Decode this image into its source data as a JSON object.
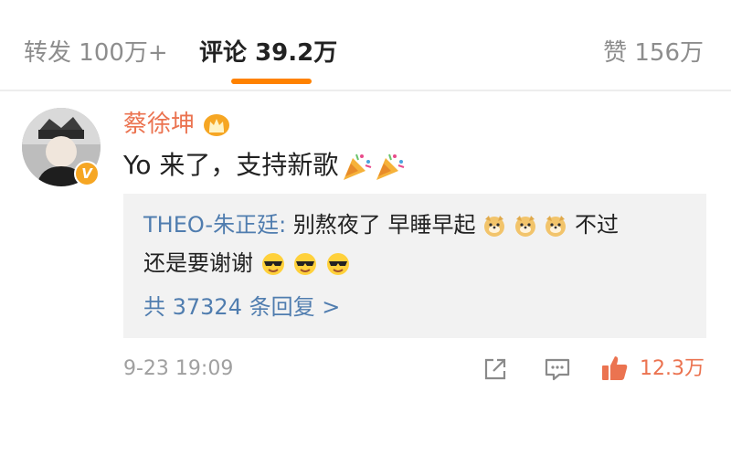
{
  "tabs": {
    "repost_label": "转发",
    "repost_count": "100万+",
    "comments_label": "评论",
    "comments_count": "39.2万",
    "likes_label": "赞",
    "likes_count": "156万"
  },
  "comment": {
    "username": "蔡徐坤",
    "text": "Yo 来了，支持新歌",
    "emoji": [
      "party-popper",
      "party-popper"
    ],
    "time": "9-23 19:09",
    "like_count": "12.3万"
  },
  "reply": {
    "user": "THEO-朱正廷",
    "separator": ": ",
    "text_part1": "别熬夜了 早睡早起",
    "emoji_part1": [
      "doge",
      "doge",
      "doge"
    ],
    "text_part2": " 不过",
    "line2_text": "还是要谢谢",
    "emoji_part2": [
      "cool-face",
      "cool-face",
      "cool-face"
    ],
    "reply_count": "共 37324 条回复 >"
  },
  "colors": {
    "accent_orange": "#ff8200",
    "username_color": "#eb7350",
    "link_blue": "#507daf",
    "muted_gray": "#8d8d8d",
    "reply_bg": "#f2f2f2"
  }
}
